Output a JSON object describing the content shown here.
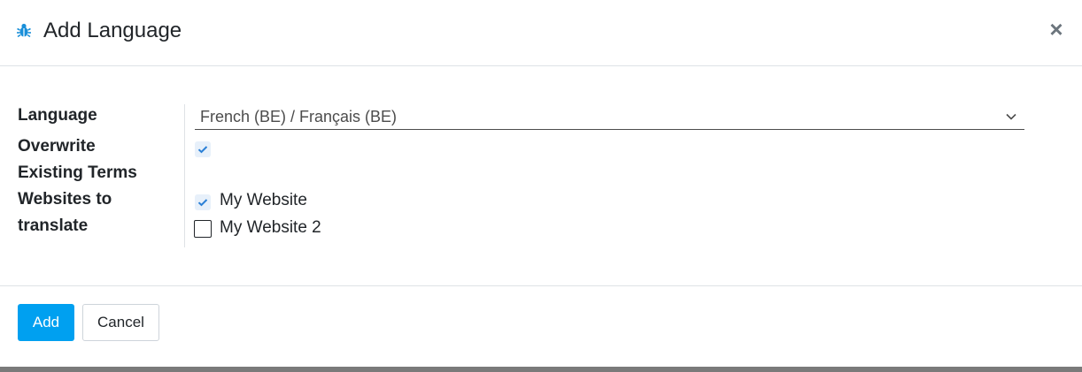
{
  "dialog": {
    "title": "Add Language",
    "close_label": "×",
    "icon": "bug-icon"
  },
  "form": {
    "language_label": "Language",
    "language_value": "French (BE) / Français (BE)",
    "overwrite_label_line1": "Overwrite",
    "overwrite_label_line2": "Existing Terms",
    "overwrite_checked": true,
    "websites_label_line1": "Websites to",
    "websites_label_line2": "translate",
    "websites": [
      {
        "label": "My Website",
        "checked": true
      },
      {
        "label": "My Website 2",
        "checked": false
      }
    ]
  },
  "footer": {
    "add_label": "Add",
    "cancel_label": "Cancel"
  },
  "colors": {
    "primary": "#00a0f0",
    "icon_blue": "#1a8fd9",
    "check_blue": "#2a7fd6"
  }
}
